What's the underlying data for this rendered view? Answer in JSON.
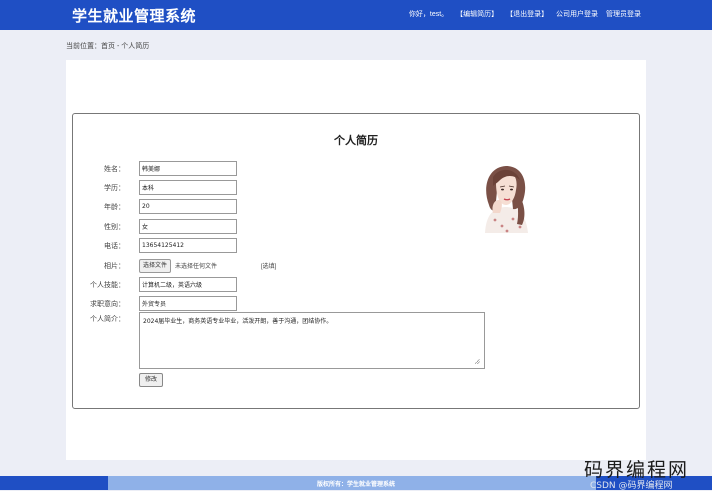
{
  "header": {
    "site_title": "学生就业管理系统",
    "greeting": "你好，test。",
    "nav": [
      "【编辑简历】",
      "【退出登录】",
      "公司用户登录",
      "管理员登录"
    ]
  },
  "breadcrumb": "当前位置：首页 - 个人简历",
  "form": {
    "title": "个人简历",
    "fields": [
      {
        "label": "姓名：",
        "value": "韩美娜"
      },
      {
        "label": "学历：",
        "value": "本科"
      },
      {
        "label": "年龄：",
        "value": "20"
      },
      {
        "label": "性别：",
        "value": "女"
      },
      {
        "label": "电话：",
        "value": "13654125412"
      }
    ],
    "photo": {
      "label": "相片：",
      "button": "选择文件",
      "status": "未选择任何文件",
      "optional": "[选填]"
    },
    "skills": {
      "label": "个人技能：",
      "value": "计算机二级，英语六级"
    },
    "job": {
      "label": "求职意向：",
      "value": "外贸专员"
    },
    "intro": {
      "label": "个人简介：",
      "value": "2024届毕业生，商务英语专业毕业，活泼开朗，善于沟通，团结协作。"
    },
    "submit": "修改"
  },
  "avatar_icon": "female-portrait-illustration",
  "footer": {
    "copyright": "版权所有：学生就业管理系统"
  },
  "watermark": {
    "main": "码界编程网",
    "sub": "CSDN @码界编程网"
  },
  "colors": {
    "header": "#1f4fc4",
    "footer_band": "#8fb1e8",
    "background": "#eceef6"
  }
}
